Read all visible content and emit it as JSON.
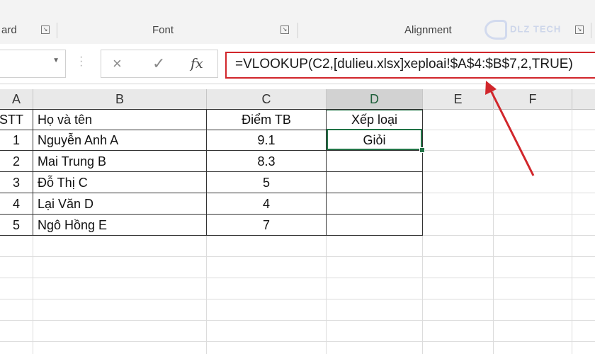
{
  "ribbon": {
    "groups": [
      {
        "label": "ard"
      },
      {
        "label": "Font"
      },
      {
        "label": "Alignment"
      }
    ],
    "watermark": "DLZ TECH"
  },
  "formula_bar": {
    "name_box_value": "",
    "cancel_icon": "×",
    "enter_icon": "✓",
    "fx_label": "fx",
    "formula": "=VLOOKUP(C2,[dulieu.xlsx]xeploai!$A$4:$B$7,2,TRUE)"
  },
  "grid": {
    "columns": [
      "A",
      "B",
      "C",
      "D",
      "E",
      "F"
    ],
    "selected_column": "D",
    "header_row": [
      "STT",
      "Họ và tên",
      "Điểm TB",
      "Xếp loại"
    ],
    "rows": [
      {
        "stt": "1",
        "name": "Nguyễn Anh A",
        "score": "9.1",
        "rank": "Giỏi"
      },
      {
        "stt": "2",
        "name": "Mai Trung B",
        "score": "8.3",
        "rank": ""
      },
      {
        "stt": "3",
        "name": "Đỗ Thị C",
        "score": "5",
        "rank": ""
      },
      {
        "stt": "4",
        "name": "Lại Văn D",
        "score": "4",
        "rank": ""
      },
      {
        "stt": "5",
        "name": "Ngô Hồng E",
        "score": "7",
        "rank": ""
      }
    ]
  },
  "colors": {
    "highlight_red": "#d1262b",
    "selection_green": "#217346"
  }
}
